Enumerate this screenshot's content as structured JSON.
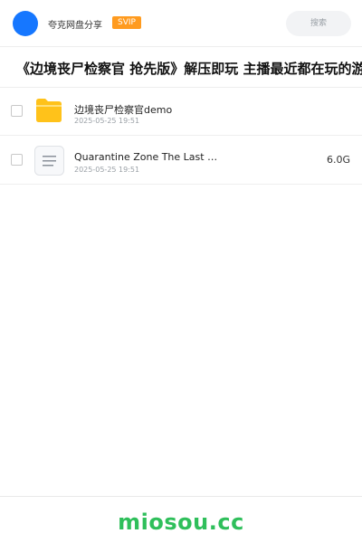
{
  "header": {
    "username": "夸克网盘分享",
    "badge": "SVIP",
    "search_label": "搜索"
  },
  "share": {
    "title": "《边境丧尸检察官 抢先版》解压即玩 主播最近都在玩的游戏"
  },
  "files": [
    {
      "name": "边境丧尸检察官demo",
      "date": "2025-05-25 19:51",
      "size": "",
      "icon": "folder-icon"
    },
    {
      "name": "Quarantine Zone The Last …",
      "date": "2025-05-25 19:51",
      "size": "6.0G",
      "icon": "document-icon"
    }
  ],
  "footer": {
    "brand": "miosou.cc"
  },
  "colors": {
    "accent": "#1677ff",
    "svip": "#ff9b1f",
    "folder": "#ffc21a",
    "brand": "#2fbf5b"
  }
}
